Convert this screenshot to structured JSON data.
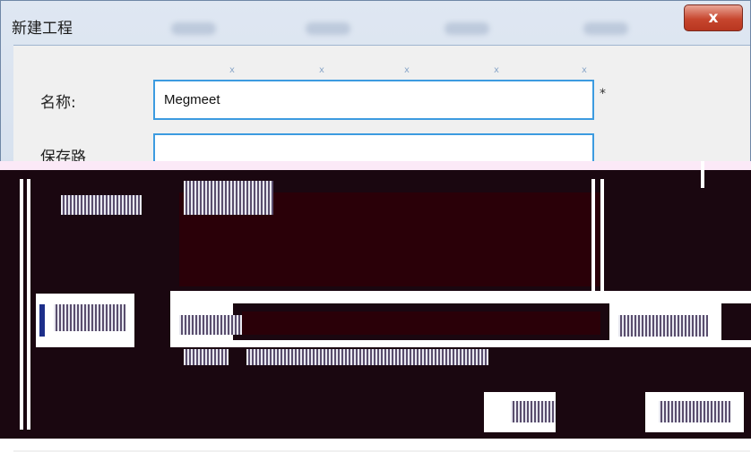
{
  "window": {
    "title": "新建工程",
    "close_glyph": "x"
  },
  "form": {
    "name_label": "名称:",
    "name_value": "Megmeet",
    "required_mark": "*",
    "path_label": "保存路"
  }
}
